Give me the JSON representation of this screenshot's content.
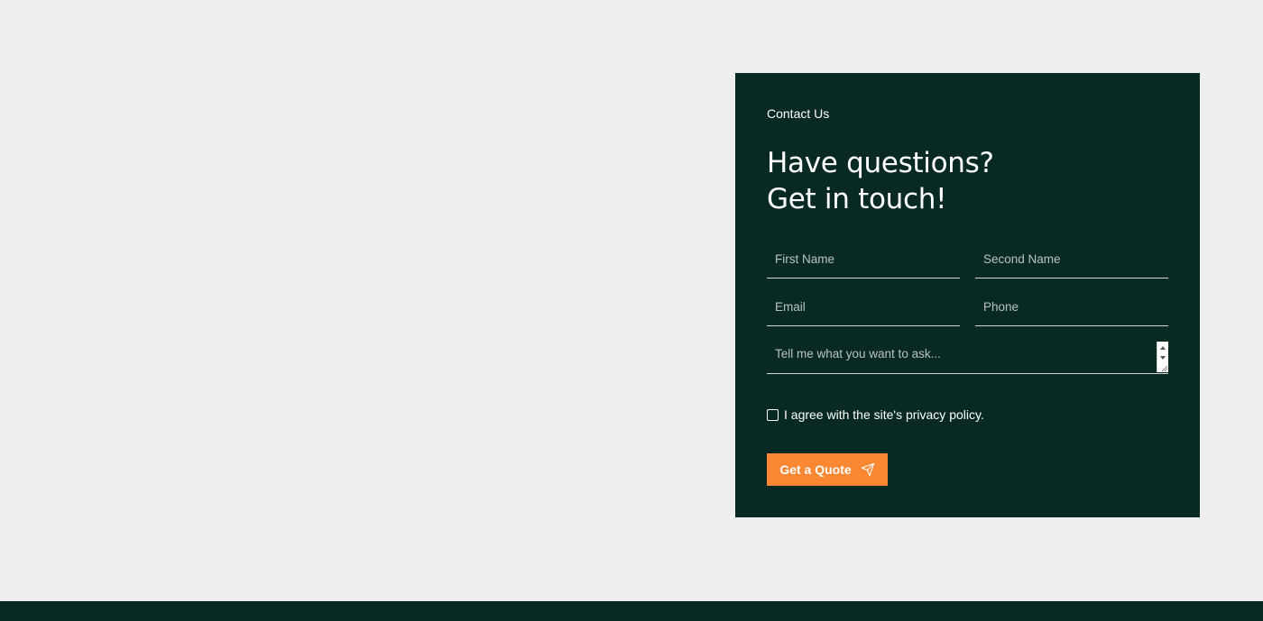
{
  "contact": {
    "eyebrow": "Contact Us",
    "heading_line1": "Have questions?",
    "heading_line2": "Get in touch!",
    "fields": {
      "first_name": {
        "placeholder": "First Name",
        "value": ""
      },
      "second_name": {
        "placeholder": "Second Name",
        "value": ""
      },
      "email": {
        "placeholder": "Email",
        "value": ""
      },
      "phone": {
        "placeholder": "Phone",
        "value": ""
      },
      "message": {
        "placeholder": "Tell me what you want to ask...",
        "value": ""
      }
    },
    "privacy": {
      "label": "I agree with the site's privacy policy.",
      "checked": false
    },
    "submit": {
      "label": "Get a Quote",
      "icon": "send-icon"
    }
  },
  "colors": {
    "background": "#eeeeee",
    "card": "#092a24",
    "accent": "#fb8732",
    "text": "#ffffff"
  }
}
